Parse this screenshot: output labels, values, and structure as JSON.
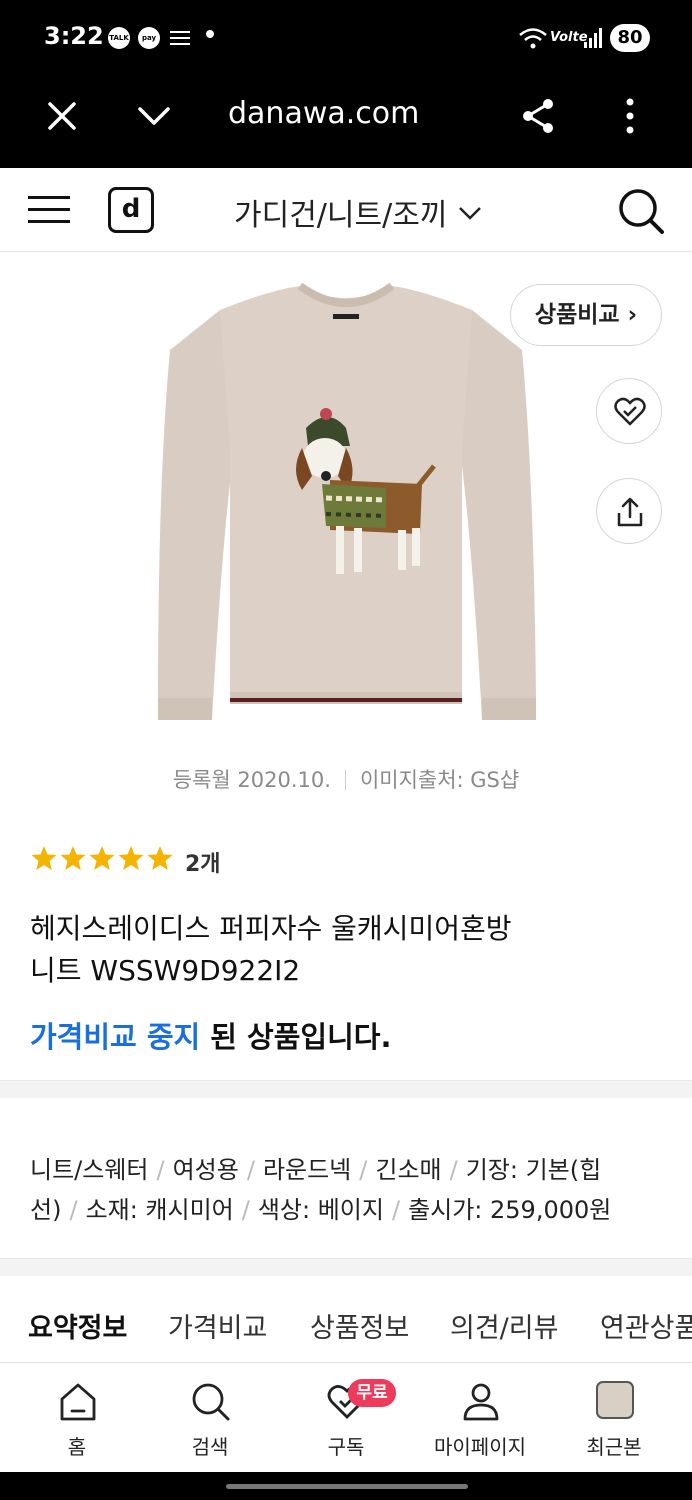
{
  "status_bar": {
    "time": "3:22",
    "icons": [
      "talk-icon",
      "pay-icon",
      "list-icon",
      "dot"
    ],
    "battery": "80",
    "network": "Volte"
  },
  "browser": {
    "url": "danawa.com",
    "icons": [
      "close-icon",
      "chevron-down-icon",
      "share-icon",
      "more-icon"
    ]
  },
  "header": {
    "logo": "d",
    "category": "가디건/니트/조끼"
  },
  "product": {
    "compare_button": "상품비교",
    "meta_date": "등록월 2020.10.",
    "meta_source": "이미지출처: GS샵",
    "rating_stars": 5,
    "review_count": "2개",
    "title_line1": "헤지스레이디스 퍼피자수 울캐시미어혼방",
    "title_line2": "니트 WSSW9D922I2",
    "notice_highlight": "가격비교 중지",
    "notice_rest": " 된 상품입니다."
  },
  "specs": {
    "line1": [
      "니트/스웨터",
      "여성용",
      "라운드넥",
      "긴소매",
      "기장: 기본(힙"
    ],
    "line2": [
      "선)",
      "소재: 캐시미어",
      "색상: 베이지",
      "출시가: 259,000원"
    ]
  },
  "tabs": [
    "요약정보",
    "가격비교",
    "상품정보",
    "의견/리뷰",
    "연관상품"
  ],
  "bottom_nav": [
    {
      "label": "홈",
      "icon": "home-icon"
    },
    {
      "label": "검색",
      "icon": "search-icon"
    },
    {
      "label": "구독",
      "icon": "subscribe-icon",
      "badge": "무료"
    },
    {
      "label": "마이페이지",
      "icon": "person-icon"
    },
    {
      "label": "최근본",
      "icon": "recent-thumbnail"
    }
  ],
  "colors": {
    "accent_blue": "#1a6fe0",
    "star": "#f5b400",
    "badge": "#ee3b5b",
    "sweater": "#d9cdc3"
  }
}
